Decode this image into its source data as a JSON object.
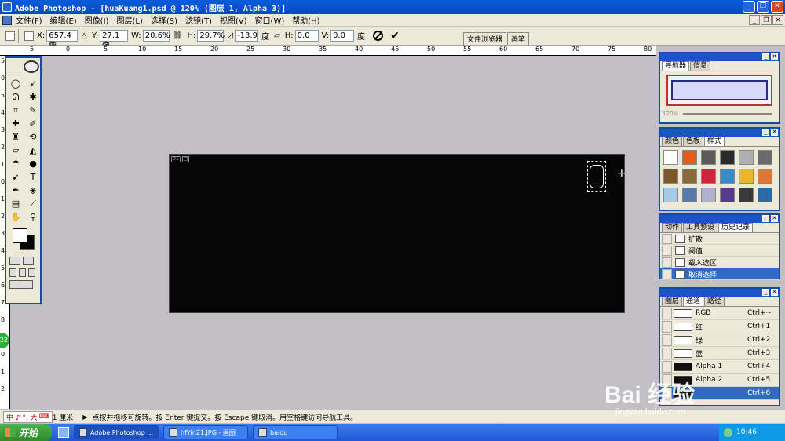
{
  "titlebar": {
    "title": "Adobe Photoshop - [huaKuang1.psd @ 120% (图层 1, Alpha 3)]"
  },
  "menu": [
    "文件(F)",
    "编辑(E)",
    "图像(I)",
    "图层(L)",
    "选择(S)",
    "滤镜(T)",
    "视图(V)",
    "窗口(W)",
    "帮助(H)"
  ],
  "options": {
    "x_label": "X:",
    "x_value": "657.4 像",
    "y_label": "Y:",
    "y_value": "27.1 像",
    "w_label": "W:",
    "w_value": "20.6%",
    "h_label": "H:",
    "h_value": "29.7%",
    "angle_value": "-13.9",
    "angle_unit": "度",
    "hskew_label": "H:",
    "hskew_value": "0.0",
    "vskew_label": "V:",
    "vskew_value": "0.0",
    "skew_unit": "度"
  },
  "well_tabs": [
    "文件浏览器",
    "画笔"
  ],
  "ruler_h": [
    "5",
    "0",
    "5",
    "10",
    "15",
    "20",
    "25",
    "30",
    "35",
    "40",
    "45",
    "50",
    "55",
    "60",
    "65",
    "70",
    "75",
    "80"
  ],
  "ruler_v": [
    "5",
    "0",
    "5",
    "4",
    "3",
    "2",
    "1",
    "0",
    "1",
    "2",
    "3",
    "4",
    "5",
    "6",
    "7",
    "8",
    "9",
    "0",
    "1",
    "2"
  ],
  "doc_notes": [
    "01",
    "□"
  ],
  "navigator": {
    "tabs": [
      "导航器",
      "信息"
    ],
    "zoom": "120%"
  },
  "color_panel": {
    "tabs": [
      "颜色",
      "色板",
      "样式"
    ],
    "swatches": [
      "#ffffff",
      "#e85a1a",
      "#5a5a5a",
      "#2a2a2a",
      "#b0b0b0",
      "#6a6a6a",
      "#7a5a2a",
      "#8a6a3a",
      "#c8283a",
      "#3a8ac8",
      "#e8b82a",
      "#d8783a",
      "#a8c8e8",
      "#5a7aa8",
      "#b0b0d0",
      "#5a3a8a",
      "#3a3a3a",
      "#2a6aa8"
    ]
  },
  "history": {
    "tabs": [
      "动作",
      "工具预设",
      "历史记录"
    ],
    "items": [
      "扩散",
      "阈值",
      "载入选区",
      "取消选择"
    ]
  },
  "channels": {
    "tabs": [
      "图层",
      "通道",
      "路径"
    ],
    "rows": [
      {
        "name": "RGB",
        "key": "Ctrl+~"
      },
      {
        "name": "红",
        "key": "Ctrl+1"
      },
      {
        "name": "绿",
        "key": "Ctrl+2"
      },
      {
        "name": "蓝",
        "key": "Ctrl+3"
      },
      {
        "name": "Alpha 1",
        "key": "Ctrl+4"
      },
      {
        "name": "Alpha 2",
        "key": "Ctrl+5"
      },
      {
        "name": "",
        "key": "Ctrl+6"
      }
    ]
  },
  "status": {
    "ime_text": "中 ♪ °, 大",
    "unit": "1 厘米",
    "message": "点按并拖移可旋转。按 Enter 键提交。按 Escape 键取消。用空格键访问导航工具。"
  },
  "taskbar": {
    "start": "开始",
    "tasks": [
      "Adobe Photoshop ...",
      "hfYin21.JPG - 画图",
      "baidu"
    ],
    "clock": "10:46"
  },
  "side_badge": "22",
  "watermark": {
    "logo": "Bai 经验",
    "url": "jingyan.baidu.com"
  }
}
